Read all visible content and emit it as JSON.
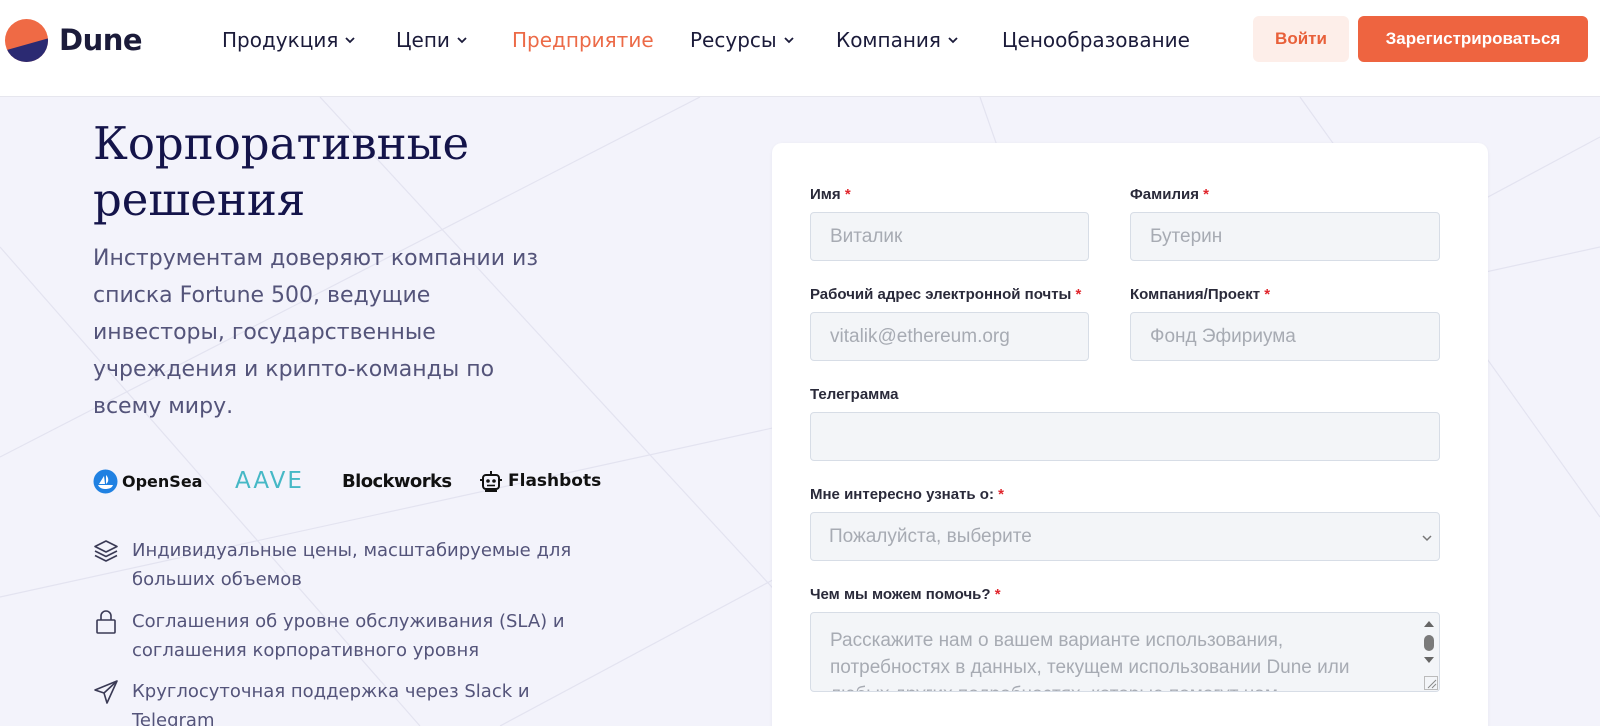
{
  "brand": {
    "name": "Dune"
  },
  "nav": {
    "items": [
      {
        "label": "Продукция",
        "has_dropdown": true,
        "active": false
      },
      {
        "label": "Цепи",
        "has_dropdown": true,
        "active": false
      },
      {
        "label": "Предприятие",
        "has_dropdown": false,
        "active": true
      },
      {
        "label": "Ресурсы",
        "has_dropdown": true,
        "active": false
      },
      {
        "label": "Компания",
        "has_dropdown": true,
        "active": false
      },
      {
        "label": "Ценообразование",
        "has_dropdown": false,
        "active": false
      }
    ],
    "login_label": "Войти",
    "signup_label": "Зарегистрироваться"
  },
  "hero": {
    "title_line1": "Корпоративные",
    "title_line2": "решения",
    "subtitle_lines": [
      "Инструментам доверяют компании из",
      "списка Fortune 500, ведущие",
      "инвесторы, государственные",
      "учреждения и крипто-команды по",
      "всему миру."
    ]
  },
  "partners": [
    "OpenSea",
    "AAVE",
    "Blockworks",
    "Flashbots"
  ],
  "features": [
    {
      "icon": "layers-icon",
      "lines": [
        "Индивидуальные цены, масштабируемые для",
        "больших объемов"
      ]
    },
    {
      "icon": "lock-icon",
      "lines": [
        "Соглашения об уровне обслуживания (SLA) и",
        "соглашения корпоративного уровня"
      ]
    },
    {
      "icon": "send-icon",
      "lines": [
        "Круглосуточная поддержка через Slack и Telegram"
      ]
    }
  ],
  "form": {
    "first_name": {
      "label": "Имя",
      "required_mark": "*",
      "placeholder": "Виталик",
      "value": ""
    },
    "last_name": {
      "label": "Фамилия",
      "required_mark": "*",
      "placeholder": "Бутерин",
      "value": ""
    },
    "email": {
      "label": "Рабочий адрес электронной почты",
      "required_mark": "*",
      "placeholder": "vitalik@ethereum.org",
      "value": ""
    },
    "company": {
      "label": "Компания/Проект",
      "required_mark": "*",
      "placeholder": "Фонд Эфириума",
      "value": ""
    },
    "telegram": {
      "label": "Телеграмма",
      "placeholder": "",
      "value": ""
    },
    "interest": {
      "label": "Мне интересно узнать о:",
      "required_mark": "*",
      "selected": "Пожалуйста, выберите"
    },
    "help": {
      "label": "Чем мы можем помочь?",
      "required_mark": "*",
      "placeholder_lines": [
        "Расскажите нам о вашем варианте использования,",
        "потребностях в данных, текущем использовании Dune или",
        "любых других подробностях, которые помогут нам"
      ]
    }
  },
  "colors": {
    "accent": "#ee6440",
    "accent_light": "#fdeee9",
    "heading": "#14144a",
    "body_text": "#54547a",
    "background": "#f3f3fb",
    "required": "#e0262c"
  }
}
